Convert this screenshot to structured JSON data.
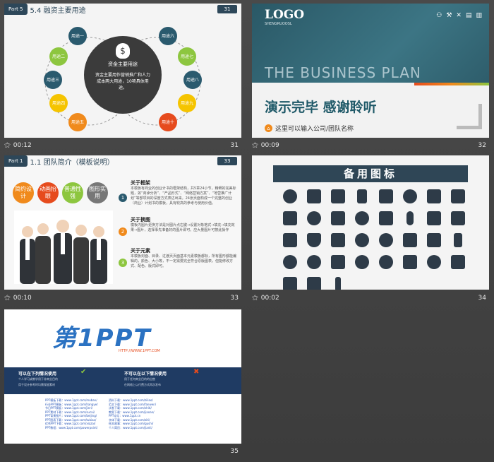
{
  "slides": [
    {
      "number": "31",
      "time": "00:12",
      "part": "Part 5",
      "title": "5.4 融资主要用途",
      "center_title": "资金主要用途",
      "center_body": "资金主要用作营销推广和人力成本两大用途，10项具体用途。",
      "nodes": [
        "用途一",
        "用途二",
        "用途三",
        "用途四",
        "用途五",
        "用途六",
        "用途七",
        "用途八",
        "用途九",
        "用途十"
      ]
    },
    {
      "number": "32",
      "time": "00:09",
      "logo": "LOGO",
      "logo_sub": "SHENGRUOOSL",
      "banner": "THE BUSINESS PLAN",
      "heading": "演示完毕  感谢聆听",
      "subline": "这里可以输入公司/团队名称"
    },
    {
      "number": "33",
      "time": "00:10",
      "part": "Part 1",
      "title": "1.1 团队简介（模板说明）",
      "tags": [
        "简约设计",
        "动画抬眼",
        "普通性强",
        "图形实用"
      ],
      "items": [
        {
          "n": "1",
          "title": "关于框架",
          "body": "本模板有商业的创业计书的框架结构，共5章24小节，精细的完美标题，如“商承分析”、“产品形式”、“网络营销方案”、“地营推广计划”等部项目的深度方式表达出来。24张页面构成一个完整的创业（商业）计划书的模板，具有较高的参考与使用价值。"
        },
        {
          "n": "2",
          "title": "关于换图",
          "body": "模板内图片更换方法是对图片点右键→设置对象格式→填充→填充效果→图片，选择事先准备好的图片即可。应大量图片可按此操作"
        },
        {
          "n": "3",
          "title": "关于元素",
          "body": "本模板封面、目录、过渡页页面基本元素模板都标，所有图形都能编辑的，颜色、大小等，不一定需要完全符合原版图表，但能修改方式、配色、版式即可。"
        }
      ]
    },
    {
      "number": "34",
      "time": "00:02",
      "title": "备用图标"
    },
    {
      "number": "35",
      "brand": "第1PPT",
      "url": "HTTP://WWW.1PPT.COM",
      "left_title": "可以在下列情况使用",
      "left_lines": [
        "个人学习或教学用于非商业目的",
        "用于设计参考时均需保留素材"
      ],
      "right_title": "不可以在以下情况使用",
      "right_lines": [
        "用于任何商业目的的出售",
        "在网络上以付费方式再次发布"
      ],
      "links_left": [
        "PPT模板下载：www.1ppt.com/moban/",
        "行业PPT模板：www.1ppt.com/hangye/",
        "节日PPT模板：www.1ppt.com/jieri/",
        "PPT素材下载：www.1ppt.com/sucai/",
        "PPT背景图片：www.1ppt.com/beijing/",
        "PPT图表下载：www.1ppt.com/tubiao/",
        "优秀PPT下载：www.1ppt.com/xiazai/",
        "PPT教程：www.1ppt.com/powerpoint/"
      ],
      "links_right": [
        "资料下载：www.1ppt.com/ziliao/",
        "范文下载：www.1ppt.com/fanwen/",
        "试卷下载：www.1ppt.com/shiti/",
        "教案下载：www.1ppt.com/jiaoan/",
        "PPT论坛：www.1ppt.cn",
        "字体下载：www.1ppt.com/ziti/",
        "绘本故事：www.1ppt.com/gushi/",
        "个人简历：www.1ppt.com/jianli/"
      ]
    }
  ],
  "colors": {
    "teal": "#2a5a6e",
    "green": "#8dc63f",
    "yellow": "#f5c400",
    "orange": "#f08a1c",
    "red": "#e64b1d",
    "navy": "#2d4759"
  }
}
